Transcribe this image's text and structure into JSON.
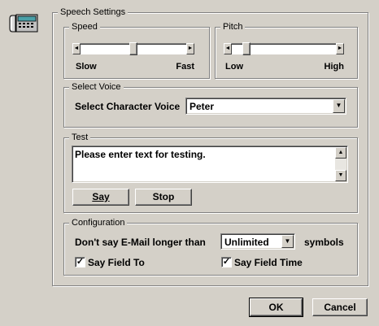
{
  "icon": "telephone-icon",
  "speech_settings": {
    "title": "Speech Settings",
    "speed": {
      "title": "Speed",
      "min_label": "Slow",
      "max_label": "Fast",
      "level": 0.5
    },
    "pitch": {
      "title": "Pitch",
      "min_label": "Low",
      "max_label": "High",
      "level": 0.1
    },
    "select_voice": {
      "title": "Select Voice",
      "label": "Select Character Voice",
      "selected": "Peter"
    },
    "test": {
      "title": "Test",
      "text": "Please enter text for testing.",
      "say_button": "Say",
      "stop_button": "Stop"
    },
    "configuration": {
      "title": "Configuration",
      "email_length_label": "Don't say E-Mail longer than",
      "email_length_value": "Unlimited",
      "symbols_label": "symbols",
      "say_field_to_label": "Say Field To",
      "say_field_to_checked": true,
      "say_field_time_label": "Say Field Time",
      "say_field_time_checked": true
    }
  },
  "buttons": {
    "ok": "OK",
    "cancel": "Cancel"
  },
  "symbols": {
    "left_arrow": "◄",
    "right_arrow": "►",
    "up_arrow": "▲",
    "down_arrow": "▼",
    "check": "✓"
  }
}
